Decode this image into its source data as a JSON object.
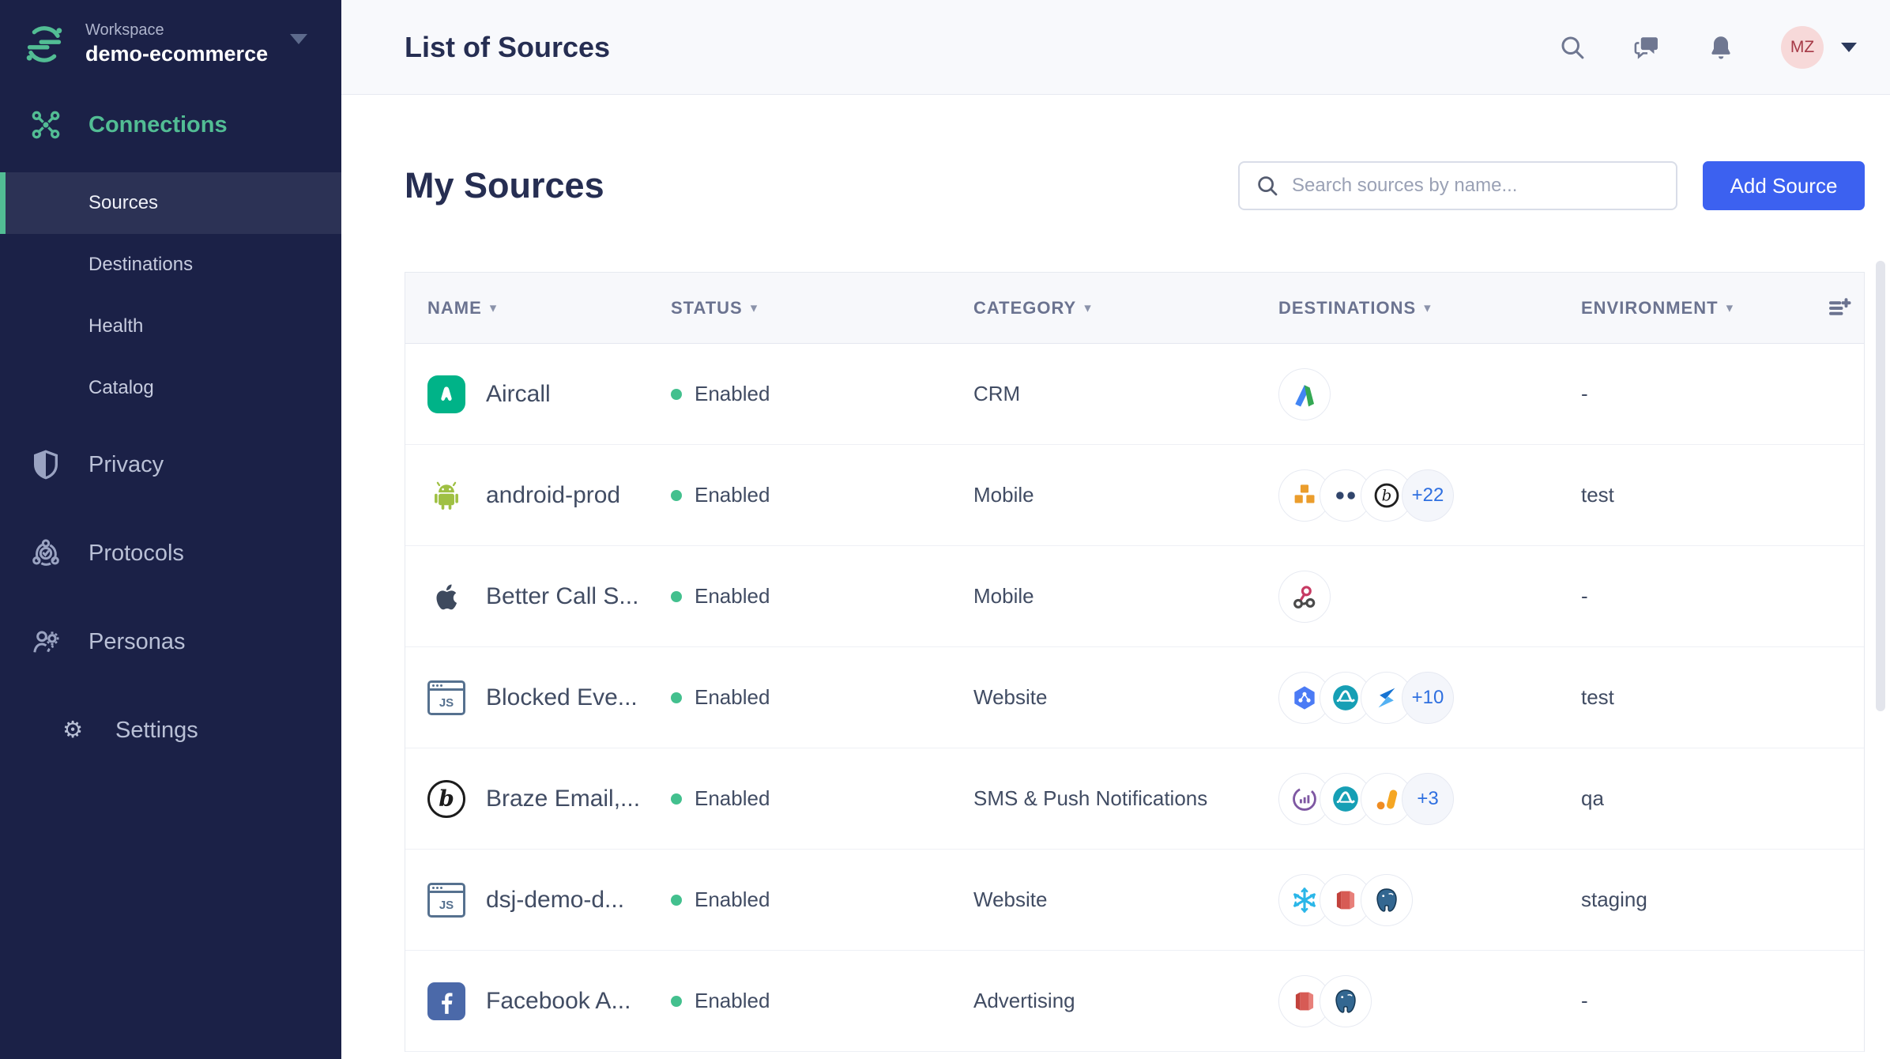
{
  "sidebar": {
    "workspace_label": "Workspace",
    "workspace_name": "demo-ecommerce",
    "connections_label": "Connections",
    "items": [
      {
        "label": "Sources",
        "active": true
      },
      {
        "label": "Destinations",
        "active": false
      },
      {
        "label": "Health",
        "active": false
      },
      {
        "label": "Catalog",
        "active": false
      }
    ],
    "links": [
      {
        "label": "Privacy"
      },
      {
        "label": "Protocols"
      },
      {
        "label": "Personas"
      },
      {
        "label": "Settings"
      }
    ]
  },
  "header": {
    "title": "List of Sources",
    "avatar_initials": "MZ"
  },
  "main": {
    "title": "My Sources",
    "search_placeholder": "Search sources by name...",
    "add_source_label": "Add Source"
  },
  "table": {
    "columns": [
      "NAME",
      "STATUS",
      "CATEGORY",
      "DESTINATIONS",
      "ENVIRONMENT"
    ],
    "rows": [
      {
        "name": "Aircall",
        "icon": "aircall",
        "status": "Enabled",
        "category": "CRM",
        "destinations": [
          {
            "icon": "google-ads"
          }
        ],
        "environment": "-"
      },
      {
        "name": "android-prod",
        "icon": "android",
        "status": "Enabled",
        "category": "Mobile",
        "destinations": [
          {
            "icon": "aws"
          },
          {
            "icon": "dots"
          },
          {
            "icon": "braze-dark"
          },
          {
            "badge": "+22"
          }
        ],
        "environment": "test"
      },
      {
        "name": "Better Call S...",
        "icon": "apple",
        "status": "Enabled",
        "category": "Mobile",
        "destinations": [
          {
            "icon": "webhook"
          }
        ],
        "environment": "-"
      },
      {
        "name": "Blocked Eve...",
        "icon": "js-browser",
        "status": "Enabled",
        "category": "Website",
        "destinations": [
          {
            "icon": "gcp"
          },
          {
            "icon": "amplitude"
          },
          {
            "icon": "blue-s"
          },
          {
            "badge": "+10"
          }
        ],
        "environment": "test"
      },
      {
        "name": "Braze Email,...",
        "icon": "braze",
        "status": "Enabled",
        "category": "SMS & Push Notifications",
        "destinations": [
          {
            "icon": "purple-bars"
          },
          {
            "icon": "amplitude"
          },
          {
            "icon": "google-analytics"
          },
          {
            "badge": "+3"
          }
        ],
        "environment": "qa"
      },
      {
        "name": "dsj-demo-d...",
        "icon": "js-browser",
        "status": "Enabled",
        "category": "Website",
        "destinations": [
          {
            "icon": "snowflake"
          },
          {
            "icon": "redshift"
          },
          {
            "icon": "postgres"
          }
        ],
        "environment": "staging"
      },
      {
        "name": "Facebook A...",
        "icon": "facebook",
        "status": "Enabled",
        "category": "Advertising",
        "destinations": [
          {
            "icon": "redshift"
          },
          {
            "icon": "postgres"
          }
        ],
        "environment": "-"
      }
    ]
  },
  "colors": {
    "brand_green": "#52bd94",
    "primary_blue": "#3c61f0",
    "status_enabled": "#43c08e",
    "sidebar_bg": "#1b2147",
    "avatar_bg": "#f7d9d9",
    "avatar_text": "#a63a47",
    "overflow_badge_text": "#2e6fe0"
  }
}
